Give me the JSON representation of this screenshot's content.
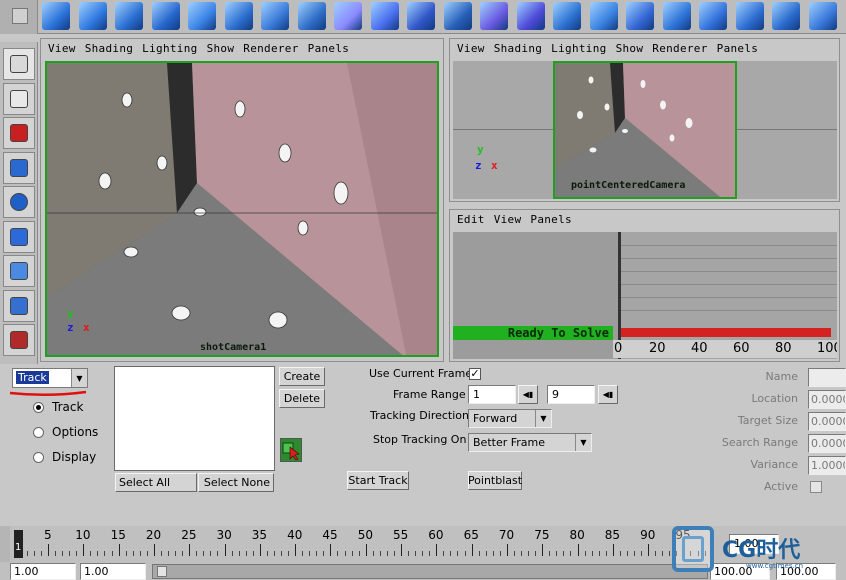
{
  "shelf": {
    "icons": [
      "sphere-icon",
      "cube-icon",
      "cylinder-icon",
      "cone-icon",
      "plane-icon",
      "torus-icon",
      "nurbs-plane-icon",
      "pipe-icon",
      "select-mode-icon",
      "snap-icon",
      "component-icon",
      "cluster-icon",
      "lattice-icon",
      "subdivision-cube-icon",
      "move-tool-icon",
      "extrude-icon",
      "mesh-icon",
      "split-icon",
      "wedge-icon",
      "bevel-icon",
      "smooth-icon",
      "merge-icon"
    ]
  },
  "toolbox": {
    "tools": [
      "select-arrow-icon",
      "lasso-select-icon",
      "paint-select-icon",
      "move-icon",
      "rotate-icon",
      "scale-icon",
      "manipulator-icon",
      "soft-mod-icon",
      "show-manipulator-icon"
    ]
  },
  "left_panel": {
    "menu": [
      "View",
      "Shading",
      "Lighting",
      "Show",
      "Renderer",
      "Panels"
    ],
    "camera": "shotCamera1",
    "axis_y": "y",
    "axis_z": "z",
    "axis_x": "x"
  },
  "right_top_panel": {
    "menu": [
      "View",
      "Shading",
      "Lighting",
      "Show",
      "Renderer",
      "Panels"
    ],
    "camera": "pointCenteredCamera",
    "axis_y": "y",
    "axis_z": "z",
    "axis_x": "x"
  },
  "graph_panel": {
    "menu": [
      "Edit",
      "View",
      "Panels"
    ],
    "status": "Ready To Solve",
    "ticks": [
      "0",
      "20",
      "40",
      "60",
      "80",
      "100"
    ]
  },
  "track_panel": {
    "mode_dropdown": "Track",
    "radios": [
      {
        "label": "Track",
        "checked": true
      },
      {
        "label": "Options",
        "checked": false
      },
      {
        "label": "Display",
        "checked": false
      }
    ],
    "create_label": "Create",
    "delete_label": "Delete",
    "select_all_label": "Select All",
    "select_none_label": "Select None",
    "use_current_frame_label": "Use Current Frame",
    "use_current_frame_checked": true,
    "frame_range_label": "Frame Range",
    "frame_start": "1",
    "frame_end": "9",
    "tracking_direction_label": "Tracking Direction",
    "tracking_direction_value": "Forward",
    "stop_tracking_label": "Stop Tracking On",
    "stop_tracking_value": "Better Frame",
    "start_track_label": "Start Track",
    "pointblast_label": "Pointblast",
    "attrs": [
      {
        "label": "Name",
        "value": ""
      },
      {
        "label": "Location",
        "value": "0.0000"
      },
      {
        "label": "Target Size",
        "value": "0.0000"
      },
      {
        "label": "Search Range",
        "value": "0.0000"
      },
      {
        "label": "Variance",
        "value": "1.0000"
      },
      {
        "label": "Active",
        "value": ""
      }
    ]
  },
  "timeline": {
    "ticks": [
      "5",
      "10",
      "15",
      "20",
      "25",
      "30",
      "35",
      "40",
      "45",
      "50",
      "55",
      "60",
      "65",
      "70",
      "75",
      "80",
      "85",
      "90",
      "95"
    ],
    "current_frame_marker": "1",
    "end_value": "1.00",
    "range_start": "1.00",
    "range_inner_start": "1.00",
    "range_end": "100.00",
    "range_end2": "100.00"
  },
  "watermark": {
    "brand": "CG时代",
    "url": "www.cgtimes.cn"
  }
}
